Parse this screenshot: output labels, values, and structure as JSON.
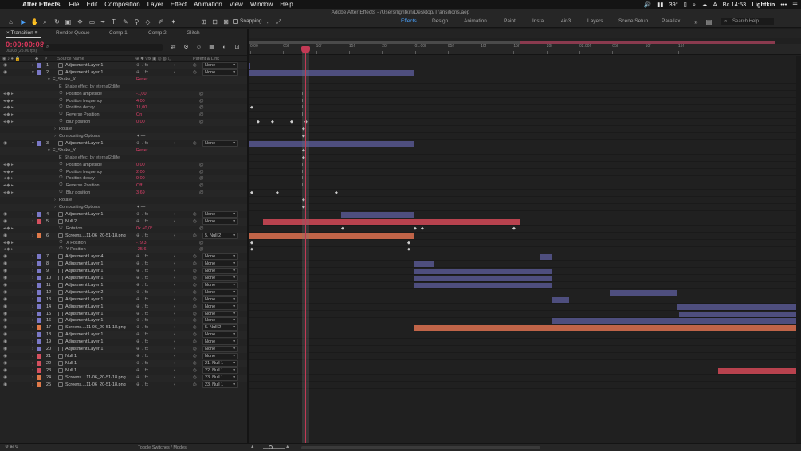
{
  "menubar": {
    "app_name": "After Effects",
    "items": [
      "File",
      "Edit",
      "Composition",
      "Layer",
      "Effect",
      "Animation",
      "View",
      "Window",
      "Help"
    ],
    "temperature": "39°",
    "clock": "Вс 14:53",
    "user": "Lightkin"
  },
  "titlebar": {
    "text": "Adobe After Effects - /Users/lightkin/Desktop/Transitions.aep"
  },
  "toolbar": {
    "snapping_label": "Snapping",
    "workspaces": [
      "Effects",
      "Design",
      "Animation",
      "Paint",
      "Insta",
      "4in3",
      "Layers",
      "Scene Setup",
      "Parallax"
    ],
    "active_workspace": "Effects",
    "search_placeholder": "Search Help"
  },
  "tabs": [
    "Transition",
    "Render Queue",
    "Comp 1",
    "Comp 2",
    "Glitch"
  ],
  "timeline": {
    "timecode": "0:00:00:08",
    "frame_info": "00008 (25.00 fps)",
    "col_source_name": "Source Name",
    "col_parent": "Parent & Link",
    "ruler_ticks": [
      "0:00",
      "05f",
      "10f",
      "15f",
      "20f",
      "01:00f",
      "05f",
      "10f",
      "15f",
      "20f",
      "02:00f",
      "05f",
      "10f",
      "15f"
    ],
    "toggle_label": "Toggle Switches / Modes"
  },
  "rows": [
    {
      "type": "layer",
      "num": "1",
      "name": "Adjustment Layer 1",
      "parent": "None",
      "label": "#7a78c7"
    },
    {
      "type": "layer",
      "num": "2",
      "name": "Adjustment Layer 1",
      "parent": "None",
      "label": "#7a78c7",
      "open": true
    },
    {
      "type": "effect",
      "name": "E_Shake_X",
      "value": "Reset"
    },
    {
      "type": "sub",
      "name": "E_Shake effect by eternal2dlife"
    },
    {
      "type": "prop",
      "name": "Position amplitude",
      "value": "-1,00"
    },
    {
      "type": "prop",
      "name": "Position frequency",
      "value": "4,00"
    },
    {
      "type": "prop",
      "name": "Position decay",
      "value": "11,00"
    },
    {
      "type": "prop",
      "name": "Reverse Position",
      "value": "On"
    },
    {
      "type": "prop",
      "name": "Blur position",
      "value": "0,00"
    },
    {
      "type": "group",
      "name": "Rotate"
    },
    {
      "type": "group",
      "name": "Compositing Options"
    },
    {
      "type": "layer",
      "num": "3",
      "name": "Adjustment Layer 1",
      "parent": "None",
      "label": "#7a78c7",
      "open": true
    },
    {
      "type": "effect",
      "name": "E_Shake_Y",
      "value": "Reset"
    },
    {
      "type": "sub",
      "name": "E_Shake effect by eternal2dlife"
    },
    {
      "type": "prop",
      "name": "Position amplitude",
      "value": "0,00"
    },
    {
      "type": "prop",
      "name": "Position frequency",
      "value": "2,00"
    },
    {
      "type": "prop",
      "name": "Position decay",
      "value": "9,00"
    },
    {
      "type": "prop",
      "name": "Reverse Position",
      "value": "Off"
    },
    {
      "type": "prop",
      "name": "Blur position",
      "value": "3,69"
    },
    {
      "type": "group",
      "name": "Rotate"
    },
    {
      "type": "group",
      "name": "Compositing Options"
    },
    {
      "type": "layer",
      "num": "4",
      "name": "Adjustment Layer 1",
      "parent": "None",
      "label": "#7a78c7"
    },
    {
      "type": "layer",
      "num": "5",
      "name": "Null 2",
      "parent": "None",
      "label": "#d4505f"
    },
    {
      "type": "prop",
      "name": "Rotation",
      "value": "0x +0,0°"
    },
    {
      "type": "layer",
      "num": "6",
      "name": "Screens....11-06_20-51-18.png",
      "parent": "5. Null 2",
      "label": "#e07a4a"
    },
    {
      "type": "prop",
      "name": "X Position",
      "value": "-79,3"
    },
    {
      "type": "prop",
      "name": "Y Position",
      "value": "-25,6"
    },
    {
      "type": "layer",
      "num": "7",
      "name": "Adjustment Layer 4",
      "parent": "None",
      "label": "#7a78c7"
    },
    {
      "type": "layer",
      "num": "8",
      "name": "Adjustment Layer 1",
      "parent": "None",
      "label": "#7a78c7"
    },
    {
      "type": "layer",
      "num": "9",
      "name": "Adjustment Layer 1",
      "parent": "None",
      "label": "#7a78c7"
    },
    {
      "type": "layer",
      "num": "10",
      "name": "Adjustment Layer 1",
      "parent": "None",
      "label": "#7a78c7"
    },
    {
      "type": "layer",
      "num": "11",
      "name": "Adjustment Layer 1",
      "parent": "None",
      "label": "#7a78c7"
    },
    {
      "type": "layer",
      "num": "12",
      "name": "Adjustment Layer 2",
      "parent": "None",
      "label": "#7a78c7"
    },
    {
      "type": "layer",
      "num": "13",
      "name": "Adjustment Layer 1",
      "parent": "None",
      "label": "#7a78c7"
    },
    {
      "type": "layer",
      "num": "14",
      "name": "Adjustment Layer 1",
      "parent": "None",
      "label": "#7a78c7"
    },
    {
      "type": "layer",
      "num": "15",
      "name": "Adjustment Layer 1",
      "parent": "None",
      "label": "#7a78c7"
    },
    {
      "type": "layer",
      "num": "16",
      "name": "Adjustment Layer 1",
      "parent": "None",
      "label": "#7a78c7"
    },
    {
      "type": "layer",
      "num": "17",
      "name": "Screens....11-06_20-51-18.png",
      "parent": "5. Null 2",
      "label": "#e07a4a"
    },
    {
      "type": "layer",
      "num": "18",
      "name": "Adjustment Layer 1",
      "parent": "None",
      "label": "#7a78c7"
    },
    {
      "type": "layer",
      "num": "19",
      "name": "Adjustment Layer 1",
      "parent": "None",
      "label": "#7a78c7"
    },
    {
      "type": "layer",
      "num": "20",
      "name": "Adjustment Layer 1",
      "parent": "None",
      "label": "#7a78c7"
    },
    {
      "type": "layer",
      "num": "21",
      "name": "Null 1",
      "parent": "None",
      "label": "#d4505f"
    },
    {
      "type": "layer",
      "num": "22",
      "name": "Null 1",
      "parent": "21. Null 1",
      "label": "#d4505f"
    },
    {
      "type": "layer",
      "num": "23",
      "name": "Null 1",
      "parent": "22. Null 1",
      "label": "#d4505f"
    },
    {
      "type": "layer",
      "num": "24",
      "name": "Screens....11-06_20-51-18.png",
      "parent": "23. Null 1",
      "label": "#e07a4a"
    },
    {
      "type": "layer",
      "num": "25",
      "name": "Screens....11-06_20-51-18.png",
      "parent": "23. Null 1",
      "label": "#e07a4a"
    }
  ],
  "colors": {
    "accent": "#d8365a",
    "adjustment_bar": "#4e4e7e",
    "null_bar": "#b8424e",
    "image_bar": "#c06448",
    "workspace_active": "#4aa3ff"
  }
}
